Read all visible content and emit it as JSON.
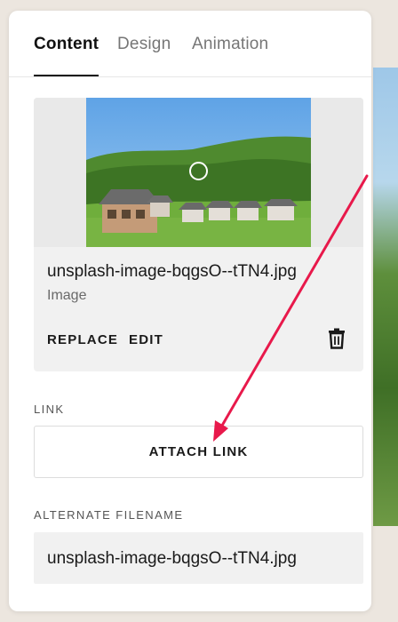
{
  "tabs": [
    {
      "label": "Content",
      "active": true
    },
    {
      "label": "Design",
      "active": false
    },
    {
      "label": "Animation",
      "active": false
    }
  ],
  "image": {
    "filename": "unsplash-image-bqgsO--tTN4.jpg",
    "type_label": "Image",
    "replace_label": "REPLACE",
    "edit_label": "EDIT",
    "delete_icon": "trash-icon"
  },
  "link": {
    "section_label": "LINK",
    "attach_label": "ATTACH LINK"
  },
  "alt_filename": {
    "section_label": "ALTERNATE FILENAME",
    "value": "unsplash-image-bqgsO--tTN4.jpg"
  },
  "colors": {
    "annotation_arrow": "#e8194b",
    "panel_bg": "#ffffff",
    "page_bg": "#ece6df",
    "card_bg": "#f1f1f1"
  }
}
